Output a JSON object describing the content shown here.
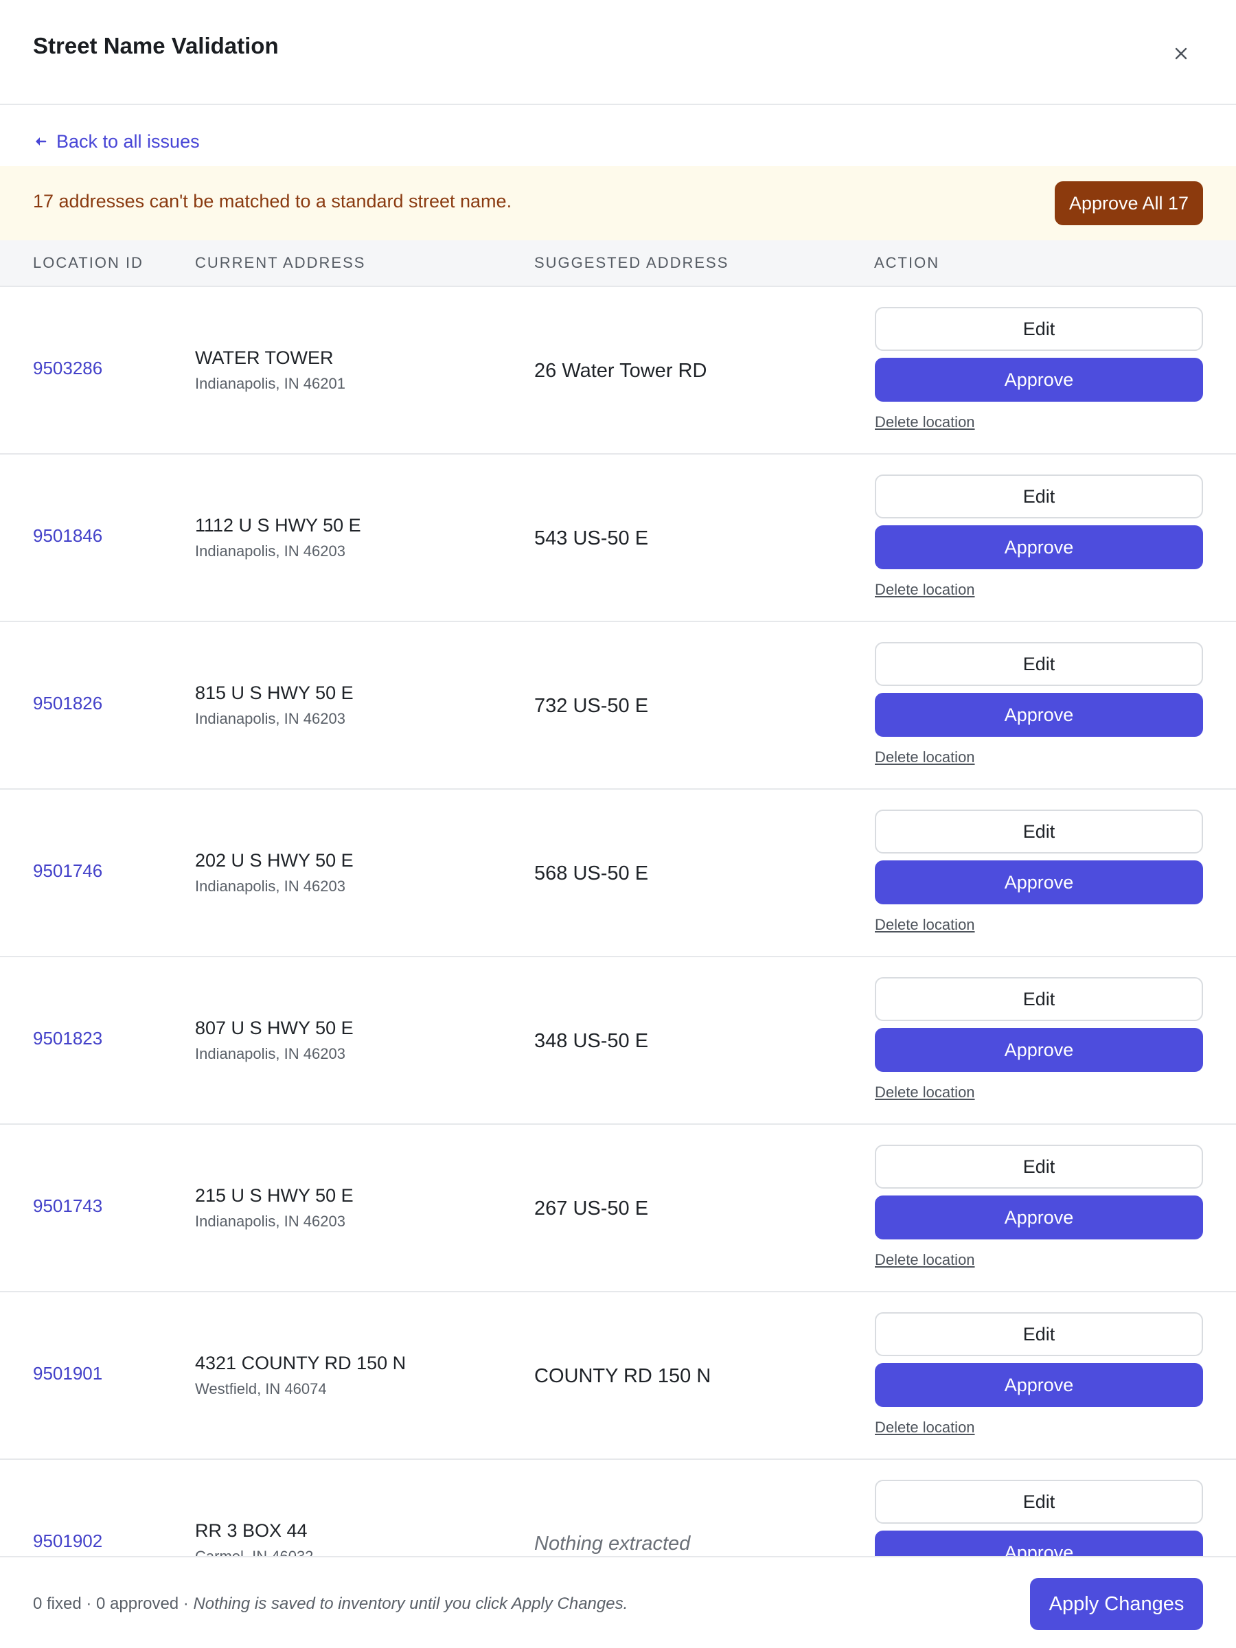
{
  "header": {
    "title": "Street Name Validation",
    "close_icon": "close-icon"
  },
  "back_link": {
    "label": "Back to all issues",
    "icon": "arrow-left-icon"
  },
  "banner": {
    "message": "17 addresses can't be matched to a standard street name.",
    "approve_all_label": "Approve All 17"
  },
  "table": {
    "columns": [
      "LOCATION ID",
      "CURRENT ADDRESS",
      "SUGGESTED ADDRESS",
      "ACTION"
    ],
    "edit_label": "Edit",
    "approve_label": "Approve",
    "delete_label": "Delete location",
    "rows": [
      {
        "location_id": "9503286",
        "current_line1": "WATER TOWER",
        "current_line2": "Indianapolis, IN 46201",
        "suggested": "26 Water Tower RD"
      },
      {
        "location_id": "9501846",
        "current_line1": "1112 U S HWY 50 E",
        "current_line2": "Indianapolis, IN 46203",
        "suggested": "543 US-50 E"
      },
      {
        "location_id": "9501826",
        "current_line1": "815 U S HWY 50 E",
        "current_line2": "Indianapolis, IN 46203",
        "suggested": "732 US-50 E"
      },
      {
        "location_id": "9501746",
        "current_line1": "202 U S HWY 50 E",
        "current_line2": "Indianapolis, IN 46203",
        "suggested": "568 US-50 E"
      },
      {
        "location_id": "9501823",
        "current_line1": "807 U S HWY 50 E",
        "current_line2": "Indianapolis, IN 46203",
        "suggested": "348 US-50 E"
      },
      {
        "location_id": "9501743",
        "current_line1": "215 U S HWY 50 E",
        "current_line2": "Indianapolis, IN 46203",
        "suggested": "267 US-50 E"
      },
      {
        "location_id": "9501901",
        "current_line1": "4321 COUNTY RD 150 N",
        "current_line2": "Westfield, IN 46074",
        "suggested": "COUNTY RD 150 N"
      },
      {
        "location_id": "9501902",
        "current_line1": "RR 3 BOX 44",
        "current_line2": "Carmel, IN 46032",
        "suggested": "Nothing extracted",
        "suggested_empty": true
      }
    ]
  },
  "footer": {
    "status": "0 fixed · 0 approved · ",
    "note": "Nothing is saved to inventory until you click Apply Changes.",
    "apply_label": "Apply Changes"
  },
  "colors": {
    "accent": "#4d4ddd",
    "link": "#4341c9",
    "banner_bg": "#fefaeb",
    "banner_text": "#8a3a10",
    "approve_all_bg": "#8c3a0d"
  }
}
